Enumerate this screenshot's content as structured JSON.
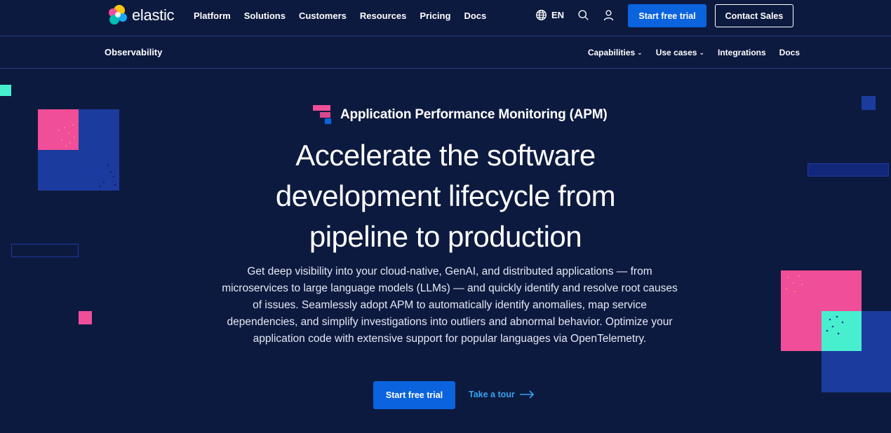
{
  "header": {
    "logo_text": "elastic",
    "nav": [
      "Platform",
      "Solutions",
      "Customers",
      "Resources",
      "Pricing",
      "Docs"
    ],
    "language": "EN",
    "start_trial": "Start free trial",
    "contact_sales": "Contact Sales"
  },
  "subnav": {
    "title": "Observability",
    "links": {
      "capabilities": "Capabilities",
      "use_cases": "Use cases",
      "integrations": "Integrations",
      "docs": "Docs"
    }
  },
  "hero": {
    "eyebrow": "Application Performance Monitoring (APM)",
    "headline": "Accelerate the software development lifecycle from pipeline to production",
    "description": "Get deep visibility into your cloud-native, GenAI, and distributed applications — from microservices to large language models (LLMs) — and quickly identify and resolve root causes of issues. Seamlessly adopt APM to automatically identify anomalies, map service dependencies, and simplify investigations into outliers and abnormal behavior. Optimize your application code with extensive support for popular languages via OpenTelemetry.",
    "cta_primary": "Start free trial",
    "cta_secondary": "Take a tour"
  },
  "colors": {
    "background": "#0d1a3f",
    "primary_button": "#0b64dd",
    "link": "#36a2ef",
    "deco_pink": "#f04e98",
    "deco_teal": "#48efcf",
    "deco_blue": "#1b3b9e"
  }
}
